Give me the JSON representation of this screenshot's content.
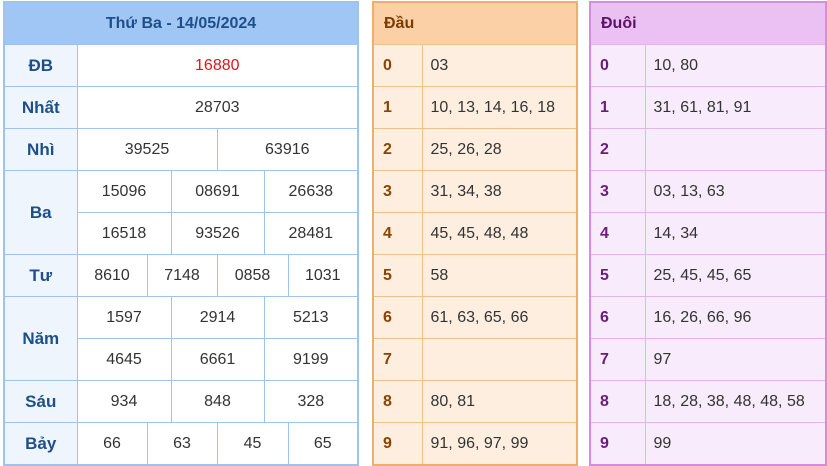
{
  "results": {
    "title": "Thứ Ba - 14/05/2024",
    "rows": [
      {
        "label": "ĐB",
        "values": [
          "16880"
        ]
      },
      {
        "label": "Nhất",
        "values": [
          "28703"
        ]
      },
      {
        "label": "Nhì",
        "values": [
          "39525",
          "63916"
        ]
      },
      {
        "label": "Ba",
        "values": [
          "15096",
          "08691",
          "26638",
          "16518",
          "93526",
          "28481"
        ]
      },
      {
        "label": "Tư",
        "values": [
          "8610",
          "7148",
          "0858",
          "1031"
        ]
      },
      {
        "label": "Năm",
        "values": [
          "1597",
          "2914",
          "5213",
          "4645",
          "6661",
          "9199"
        ]
      },
      {
        "label": "Sáu",
        "values": [
          "934",
          "848",
          "328"
        ]
      },
      {
        "label": "Bảy",
        "values": [
          "66",
          "63",
          "45",
          "65"
        ]
      }
    ]
  },
  "head": {
    "title": "Đầu",
    "rows": [
      {
        "key": "0",
        "value": "03"
      },
      {
        "key": "1",
        "value": "10, 13, 14, 16, 18"
      },
      {
        "key": "2",
        "value": "25, 26, 28"
      },
      {
        "key": "3",
        "value": "31, 34, 38"
      },
      {
        "key": "4",
        "value": "45, 45, 48, 48"
      },
      {
        "key": "5",
        "value": "58"
      },
      {
        "key": "6",
        "value": "61, 63, 65, 66"
      },
      {
        "key": "7",
        "value": ""
      },
      {
        "key": "8",
        "value": "80, 81"
      },
      {
        "key": "9",
        "value": "91, 96, 97, 99"
      }
    ]
  },
  "tail": {
    "title": "Đuôi",
    "rows": [
      {
        "key": "0",
        "value": "10, 80"
      },
      {
        "key": "1",
        "value": "31, 61, 81, 91"
      },
      {
        "key": "2",
        "value": ""
      },
      {
        "key": "3",
        "value": "03, 13, 63"
      },
      {
        "key": "4",
        "value": "14, 34"
      },
      {
        "key": "5",
        "value": "25, 45, 45, 65"
      },
      {
        "key": "6",
        "value": "16, 26, 66, 96"
      },
      {
        "key": "7",
        "value": "97"
      },
      {
        "key": "8",
        "value": "18, 28, 38, 48, 48, 58"
      },
      {
        "key": "9",
        "value": "99"
      }
    ]
  },
  "colors": {
    "special_prize": "#e0141e",
    "results_border": "#9ec3ee",
    "head_border": "#f0ad6b",
    "tail_border": "#d58be0"
  }
}
